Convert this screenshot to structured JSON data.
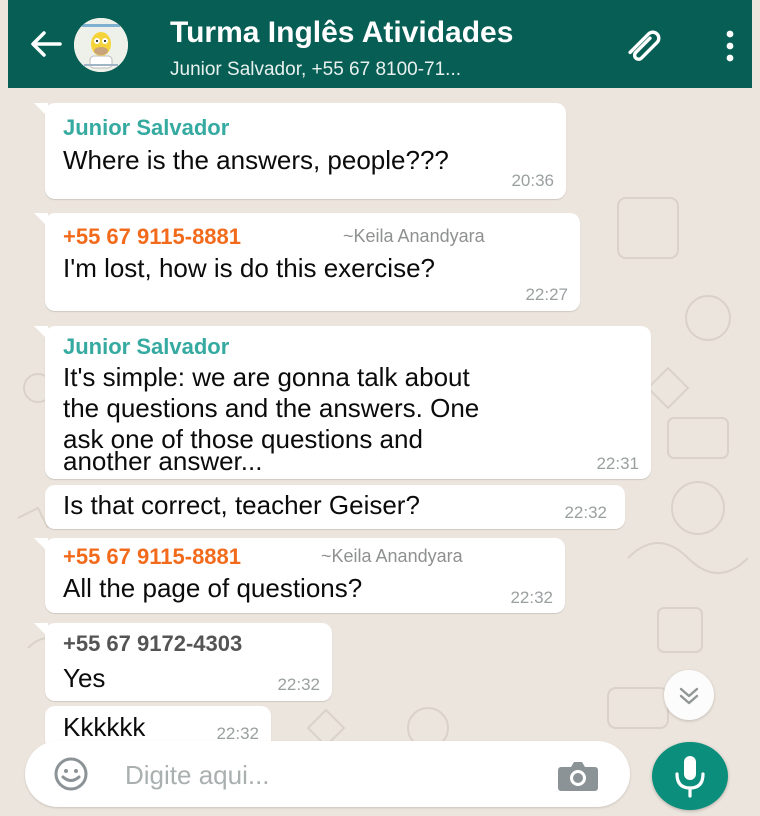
{
  "header": {
    "title": "Turma Inglês Atividades",
    "subtitle": "Junior Salvador, +55 67 8100-71...",
    "back_icon": "arrow-left-icon",
    "attach_icon": "paperclip-icon",
    "menu_icon": "more-vert-icon"
  },
  "messages": [
    {
      "sender": "Junior Salvador",
      "text": "Where is the answers, people???",
      "time": "20:36"
    },
    {
      "sender": "+55 67 9115-8881",
      "alias": "~Keila Anandyara",
      "text": "I'm lost,  how is  do this exercise?",
      "time": "22:27"
    },
    {
      "sender": "Junior Salvador",
      "lines": [
        "It's simple: we are gonna talk about",
        "the questions and the answers. One",
        "ask one of those questions and",
        "another answer..."
      ],
      "time": "22:31"
    },
    {
      "text": "Is that correct, teacher Geiser?",
      "time": "22:32"
    },
    {
      "sender": "+55 67 9115-8881",
      "alias": "~Keila Anandyara",
      "text": "All the page of questions?",
      "time": "22:32"
    },
    {
      "sender": "+55 67 9172-4303",
      "text": "Yes",
      "time": "22:32"
    },
    {
      "text": "Kkkkkk",
      "time": "22:32"
    }
  ],
  "composer": {
    "placeholder": "Digite aqui...",
    "emoji_icon": "emoji-icon",
    "camera_icon": "camera-icon",
    "mic_icon": "microphone-icon"
  },
  "scroll_icon": "double-chevron-down-icon",
  "colors": {
    "header": "#075e54",
    "background": "#ece5dd",
    "bubble": "#ffffff",
    "sender_junior": "#35aaa0",
    "sender_phone": "#f26b1d",
    "sender_other": "#545454",
    "mic_button": "#0b8e7c"
  }
}
